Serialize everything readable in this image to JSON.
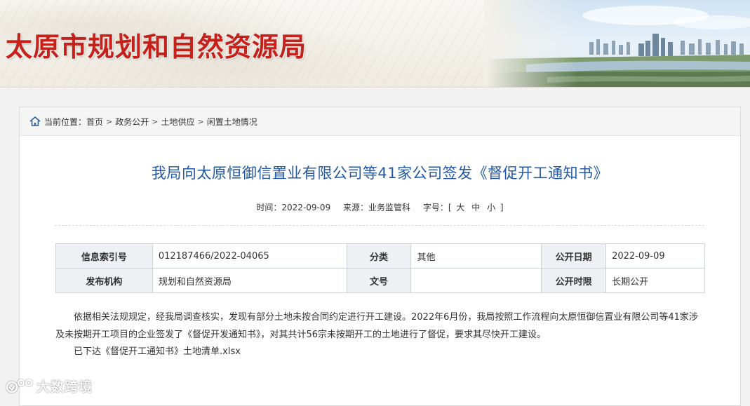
{
  "header": {
    "site_title": "太原市规划和自然资源局"
  },
  "breadcrumb": {
    "prefix": "当前位置：",
    "items": [
      "首页",
      "政务公开",
      "土地供应",
      "闲置土地情况"
    ]
  },
  "article": {
    "title": "我局向太原恒御信置业有限公司等41家公司签发《督促开工通知书》",
    "meta": {
      "time_label": "时间：",
      "time_value": "2022-09-09",
      "source_label": "来源：",
      "source_value": "业务监管科",
      "fontsize_label": "字号：",
      "fontsize_open": "[",
      "fontsize_large": "大",
      "fontsize_medium": "中",
      "fontsize_small": "小",
      "fontsize_close": "]"
    },
    "info_table": {
      "index_label": "信息索引号",
      "index_value": "012187466/2022-04065",
      "category_label": "分类",
      "category_value": "其他",
      "publish_date_label": "公开日期",
      "publish_date_value": "2022-09-09",
      "publisher_label": "发布机构",
      "publisher_value": "规划和自然资源局",
      "doc_no_label": "文号",
      "doc_no_value": "",
      "duration_label": "公开时限",
      "duration_value": "长期公开"
    },
    "body": {
      "paragraph": "依据相关法规规定，经我局调查核实，发现有部分土地未按合同约定进行开工建设。2022年6月份，我局按照工作流程向太原恒御信置业有限公司等41家涉及未按期开工项目的企业签发了《督促开发通知书》，对其共计56宗未按期开工的土地进行了督促，要求其尽快开工建设。",
      "attachment": "已下达《督促开工通知书》土地清单.xlsx"
    }
  },
  "watermark": {
    "text": "大数跨境"
  },
  "colors": {
    "title_red": "#c5201a",
    "article_title_blue": "#2258a4",
    "table_header_bg": "#eef0f4"
  }
}
